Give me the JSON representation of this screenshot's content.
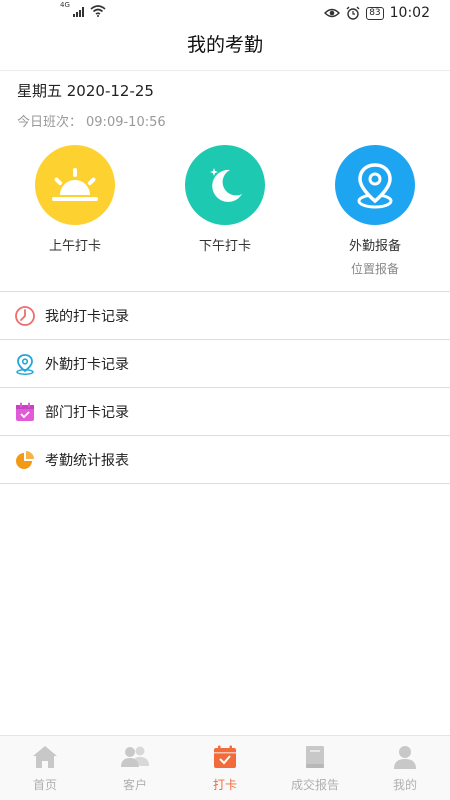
{
  "status_bar": {
    "network": "4G",
    "battery": "83",
    "time": "10:02"
  },
  "header": {
    "title": "我的考勤"
  },
  "info": {
    "date": "星期五 2020-12-25",
    "shift_label": "今日班次：",
    "shift_value": "09:09-10:56"
  },
  "actions": [
    {
      "label": "上午打卡",
      "icon": "sunrise-icon",
      "color": "#fdd230"
    },
    {
      "label": "下午打卡",
      "icon": "moon-icon",
      "color": "#1ec9b1"
    },
    {
      "label": "外勤报备",
      "sublabel": "位置报备",
      "icon": "location-pin-icon",
      "color": "#1ea5f2"
    }
  ],
  "menu": [
    {
      "label": "我的打卡记录",
      "icon": "clock-icon",
      "color": "#ee6d6d"
    },
    {
      "label": "外勤打卡记录",
      "icon": "location-icon",
      "color": "#24a7d8"
    },
    {
      "label": "部门打卡记录",
      "icon": "calendar-icon",
      "color": "#e15bd9"
    },
    {
      "label": "考勤统计报表",
      "icon": "pie-chart-icon",
      "color": "#f29a15"
    }
  ],
  "tabs": [
    {
      "label": "首页",
      "icon": "home-icon"
    },
    {
      "label": "客户",
      "icon": "customers-icon"
    },
    {
      "label": "打卡",
      "icon": "checkin-icon",
      "active": true
    },
    {
      "label": "成交报告",
      "icon": "report-book-icon"
    },
    {
      "label": "我的",
      "icon": "profile-icon"
    }
  ],
  "colors": {
    "accent": "#f26b3a",
    "tab_inactive": "#b0b0b0"
  }
}
